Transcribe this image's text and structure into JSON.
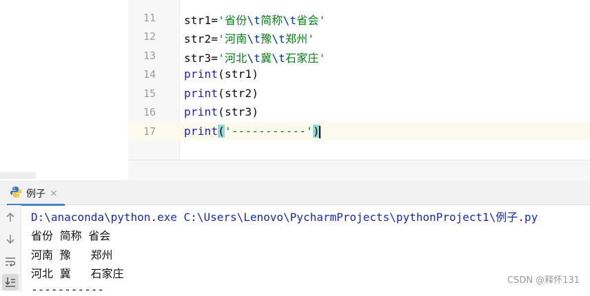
{
  "editor": {
    "line_numbers": [
      "11",
      "12",
      "13",
      "14",
      "15",
      "16",
      "17"
    ],
    "lines": {
      "l11": {
        "var": "str1",
        "eq": "=",
        "q": "'",
        "p1": "省份",
        "t1": "\\t",
        "p2": "简称",
        "t2": "\\t",
        "p3": "省会",
        "q2": "'"
      },
      "l12": {
        "var": "str2",
        "eq": "=",
        "q": "'",
        "p1": "河南",
        "t1": "\\t",
        "p2": "豫",
        "t2": "\\t",
        "p3": "郑州",
        "q2": "'"
      },
      "l13": {
        "var": "str3",
        "eq": "=",
        "q": "'",
        "p1": "河北",
        "t1": "\\t",
        "p2": "冀",
        "t2": "\\t",
        "p3": "石家庄",
        "q2": "'"
      },
      "l14": {
        "fn": "print",
        "open": "(",
        "arg": "str1",
        "close": ")"
      },
      "l15": {
        "fn": "print",
        "open": "(",
        "arg": "str2",
        "close": ")"
      },
      "l16": {
        "fn": "print",
        "open": "(",
        "arg": "str3",
        "close": ")"
      },
      "l17": {
        "fn": "print",
        "open": "(",
        "arg": "'-----------'",
        "close": ")"
      }
    }
  },
  "run": {
    "tab_label": "例子",
    "tab_close": "×",
    "output": [
      "D:\\anaconda\\python.exe C:\\Users\\Lenovo\\PycharmProjects\\pythonProject1\\例子.py",
      "省份 简称 省会",
      "河南 豫   郑州",
      "河北 冀   石家庄",
      "-----------"
    ],
    "tools": [
      "up-arrow-icon",
      "down-arrow-icon",
      "soft-wrap-icon",
      "scroll-to-end-icon"
    ]
  },
  "watermark": "CSDN @释怀131",
  "colors": {
    "keyword": "#1f1f9f",
    "string": "#067d17",
    "escape": "#0037a6",
    "tab_accent": "#4083c9"
  }
}
